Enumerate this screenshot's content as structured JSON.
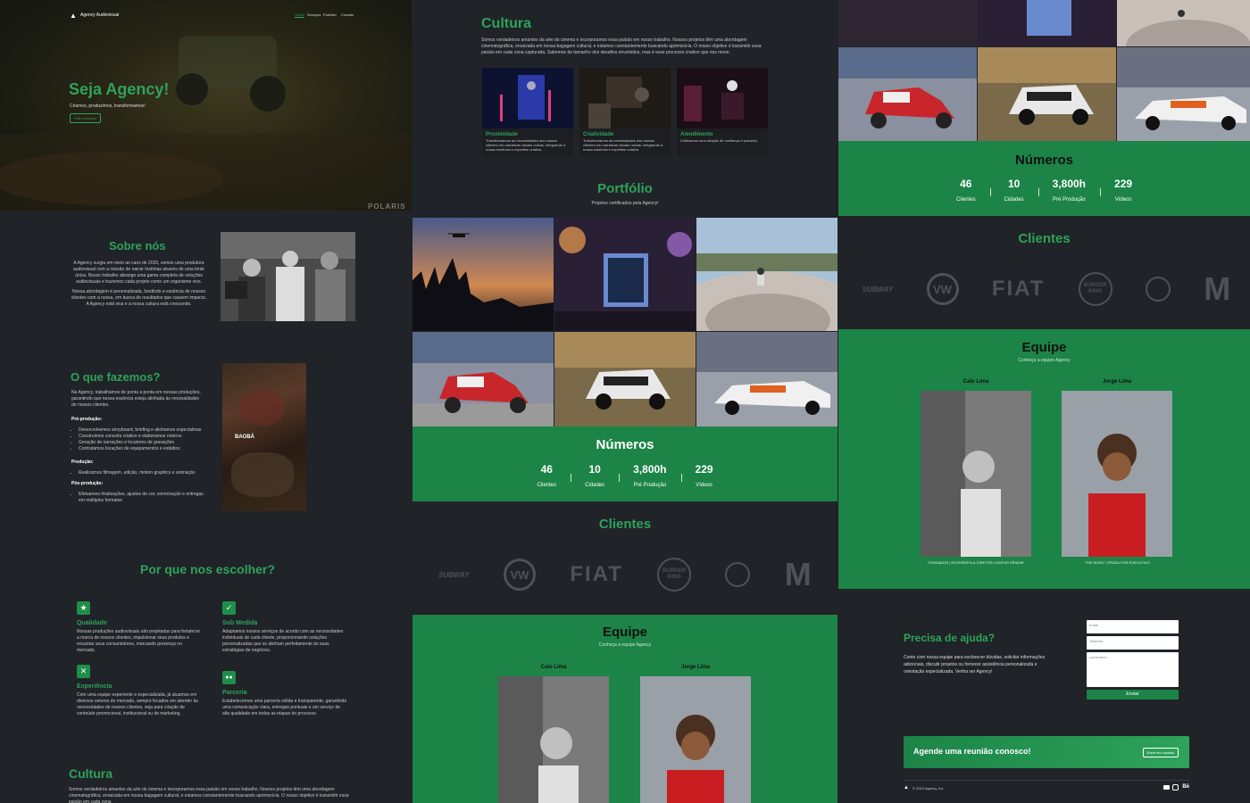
{
  "nav": {
    "brand": "Agency Audiovisual",
    "items": [
      "Home",
      "Serviços",
      "Portfólio",
      "Contato"
    ]
  },
  "hero": {
    "title": "Seja Agency!",
    "subtitle": "Criamos, produzimos, transformamos!",
    "cta": "Fale conosco!",
    "watermark": "POLARIS"
  },
  "about": {
    "title": "Sobre nós",
    "p1": "A Agency surgiu em meio ao caos de 2020, somos uma produtora audiovisual com a missão de narrar histórias através de uma lente única. Nosso trabalho abrange uma gama completa de soluções audiovisuais e trazemos cada projeto como um organismo vivo.",
    "p2": "Nossa abordagem é personalizada, fundindo a essência de nossos clientes com a nossa, em busca de resultados que causem impacto. A Agency está viva e a nossa cultura está crescendo."
  },
  "services": {
    "title": "O que fazemos?",
    "intro": "Na Agency, trabalhamos de ponta a ponta em nossas produções, garantindo que nossa essência esteja alinhada às necessidades de nossos clientes.",
    "pre_title": "Pré-produção:",
    "pre_items": [
      "Desenvolvemos storyboard, briefing e alinhamos expectativas",
      "Construímos conceito criativo e elaboramos roteiros",
      "Geração de narrações e locutores de gravações",
      "Contratamos locações de equipamentos e estúdios"
    ],
    "prod_title": "Produção:",
    "prod_items": [
      "Realizamos filmagem, edição, motion graphics e animação"
    ],
    "post_title": "Pós-produção:",
    "post_items": [
      "Efetuamos finalizações, ajustes de cor, sonorização e entregas em múltiplos formatos"
    ],
    "poster_label": "BAOBÁ"
  },
  "why": {
    "title": "Por que nos escolher?",
    "cards": [
      {
        "icon": "star-icon",
        "glyph": "★",
        "title": "Qualidade",
        "text": "Nossas produções audiovisuais são projetadas para fortalecer a marca de nossos clientes, impulsionar seus produtos e encantar seus consumidores, marcando presença no mercado."
      },
      {
        "icon": "check-icon",
        "glyph": "✓",
        "title": "Sob Medida",
        "text": "Adaptamos nossos serviços de acordo com as necessidades individuais de cada cliente, proporcionando soluções personalizadas que se alinham perfeitamente às suas estratégias de negócios."
      },
      {
        "icon": "tools-icon",
        "glyph": "✕",
        "title": "Experiência",
        "text": "Com uma equipe experiente e especializada, já atuamos em diversos setores do mercado, sempre focados em atender às necessidades de nossos clientes, seja para criação de conteúdo promocional, institucional ou de marketing."
      },
      {
        "icon": "partner-icon",
        "glyph": "👥",
        "title": "Parceria",
        "text": "Estabelecemos uma parceria sólida e transparente, garantindo uma comunicação clara, entregas pontuais e um serviço de alta qualidade em todas as etapas do processo."
      }
    ]
  },
  "culture": {
    "title": "Cultura",
    "text": "Somos verdadeiros amantes da arte do cinema e incorporamos essa paixão em nosso trabalho. Nossos projetos têm uma abordagem cinematográfica, enraizada em nossa bagagem cultural, e estamos constantemente buscando aprimorá-la. O nosso objetivo é transmitir essa paixão em cada cena capturada. Sabemos do tamanho dos desafios envolvidos, mas é esse processo criativo que nos move.",
    "text_short": "Somos verdadeiros amantes da arte do cinema e incorporamos essa paixão em nosso trabalho. Nossos projetos têm uma abordagem cinematográfica, enraizada em nossa bagagem cultural, e estamos constantemente buscando aprimorá-la. O nosso objetivo é transmitir essa paixão em cada cena",
    "cards": [
      {
        "title": "Proximidade",
        "text": "Transformamos as necessidades dos nossos clientes em narrativas visuais únicas, integrando a nossa essência e expertise criativa."
      },
      {
        "title": "Criatividade",
        "text": "Transformamos as necessidades dos nossos clientes em narrativas visuais únicas, integrando a nossa essência e expertise criativa."
      },
      {
        "title": "Atendimento",
        "text": "Cultivamos uma relação de confiança e parceria."
      }
    ]
  },
  "portfolio": {
    "title": "Portfólio",
    "subtitle": "Projetos certificados pela Agency!"
  },
  "numbers": {
    "title": "Números",
    "items": [
      {
        "value": "46",
        "label": "Clientes"
      },
      {
        "value": "10",
        "label": "Cidades"
      },
      {
        "value": "3,800h",
        "label": "Pré Produção"
      },
      {
        "value": "229",
        "label": "Vídeos"
      }
    ]
  },
  "clients": {
    "title": "Clientes",
    "logos": [
      "SUBWAY",
      "VW",
      "FIAT",
      "BURGER KING",
      "STARBUCKS",
      "M"
    ]
  },
  "team": {
    "title": "Equipe",
    "subtitle": "Conheça a equipe Agency",
    "members": [
      {
        "name": "Caio Lima",
        "role": "FUNDADOR | ROTEIRISTA & DIRETOR | EDITOR SÊNIOR"
      },
      {
        "name": "Jorge Lima",
        "role": "\"THE BOSS\" | PRODUTOR EXECUTIVO"
      }
    ]
  },
  "help": {
    "title": "Precisa de ajuda?",
    "text": "Conte com nossa equipe para esclarecer dúvidas, solicitar informações adicionais, discutir projetos ou fornecer assistência personalizada e orientação especializada. Venha ser Agency!",
    "email_ph": "Email",
    "phone_ph": "Telefone",
    "comment_ph": "comentário",
    "send": "Enviar"
  },
  "meeting": {
    "text": "Agende uma reunião conosco!",
    "button": "Entre em contato"
  },
  "footer": {
    "copyright": "© 2024 Agency, Inc"
  },
  "colors": {
    "accent": "#2ea35a",
    "band": "#1c8447",
    "bg": "#202328"
  }
}
